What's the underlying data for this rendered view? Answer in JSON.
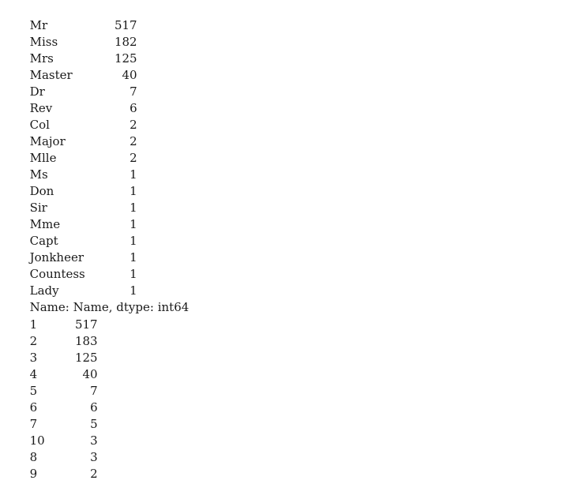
{
  "console": {
    "font_color": "#1a1a1a",
    "background": "#ffffff",
    "title_counts": {
      "rows": [
        {
          "label": "Mr",
          "count": "517"
        },
        {
          "label": "Miss",
          "count": "182"
        },
        {
          "label": "Mrs",
          "count": "125"
        },
        {
          "label": "Master",
          "count": "40"
        },
        {
          "label": "Dr",
          "count": "7"
        },
        {
          "label": "Rev",
          "count": "6"
        },
        {
          "label": "Col",
          "count": "2"
        },
        {
          "label": "Major",
          "count": "2"
        },
        {
          "label": "Mlle",
          "count": "2"
        },
        {
          "label": "Ms",
          "count": "1"
        },
        {
          "label": "Don",
          "count": "1"
        },
        {
          "label": "Sir",
          "count": "1"
        },
        {
          "label": "Mme",
          "count": "1"
        },
        {
          "label": "Capt",
          "count": "1"
        },
        {
          "label": "Jonkheer",
          "count": "1"
        },
        {
          "label": "Countess",
          "count": "1"
        },
        {
          "label": "Lady",
          "count": "1"
        }
      ],
      "footer": "Name: Name, dtype: int64"
    },
    "encoded_counts": {
      "rows": [
        {
          "index": "1",
          "count": "517"
        },
        {
          "index": "2",
          "count": "183"
        },
        {
          "index": "3",
          "count": "125"
        },
        {
          "index": "4",
          "count": "40"
        },
        {
          "index": "5",
          "count": "7"
        },
        {
          "index": "6",
          "count": "6"
        },
        {
          "index": "7",
          "count": "5"
        },
        {
          "index": "10",
          "count": "3"
        },
        {
          "index": "8",
          "count": "3"
        },
        {
          "index": "9",
          "count": "2"
        }
      ]
    }
  }
}
